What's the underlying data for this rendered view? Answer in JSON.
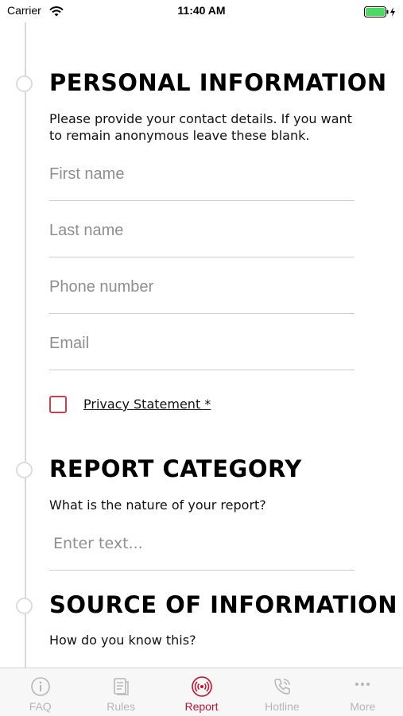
{
  "status_bar": {
    "carrier": "Carrier",
    "time": "11:40 AM"
  },
  "sections": {
    "personal": {
      "title": "PERSONAL INFORMATION",
      "description": "Please provide your contact details. If you want to remain anonymous leave these blank.",
      "first_name_placeholder": "First name",
      "last_name_placeholder": "Last name",
      "phone_placeholder": "Phone number",
      "email_placeholder": "Email",
      "privacy_label": "Privacy Statement *"
    },
    "category": {
      "title": "REPORT CATEGORY",
      "description": "What is the nature of your report?",
      "input_placeholder": "Enter text..."
    },
    "source": {
      "title": "SOURCE OF INFORMATION",
      "description": "How do you know this?"
    }
  },
  "tabbar": {
    "tabs": [
      {
        "label": "FAQ",
        "icon": "info-icon"
      },
      {
        "label": "Rules",
        "icon": "document-icon"
      },
      {
        "label": "Report",
        "icon": "broadcast-icon",
        "active": true
      },
      {
        "label": "Hotline",
        "icon": "phone-icon"
      },
      {
        "label": "More",
        "icon": "more-icon"
      }
    ]
  },
  "colors": {
    "accent": "#c8102e",
    "inactive": "#b6b6b6",
    "divider": "#cfcfcf"
  }
}
